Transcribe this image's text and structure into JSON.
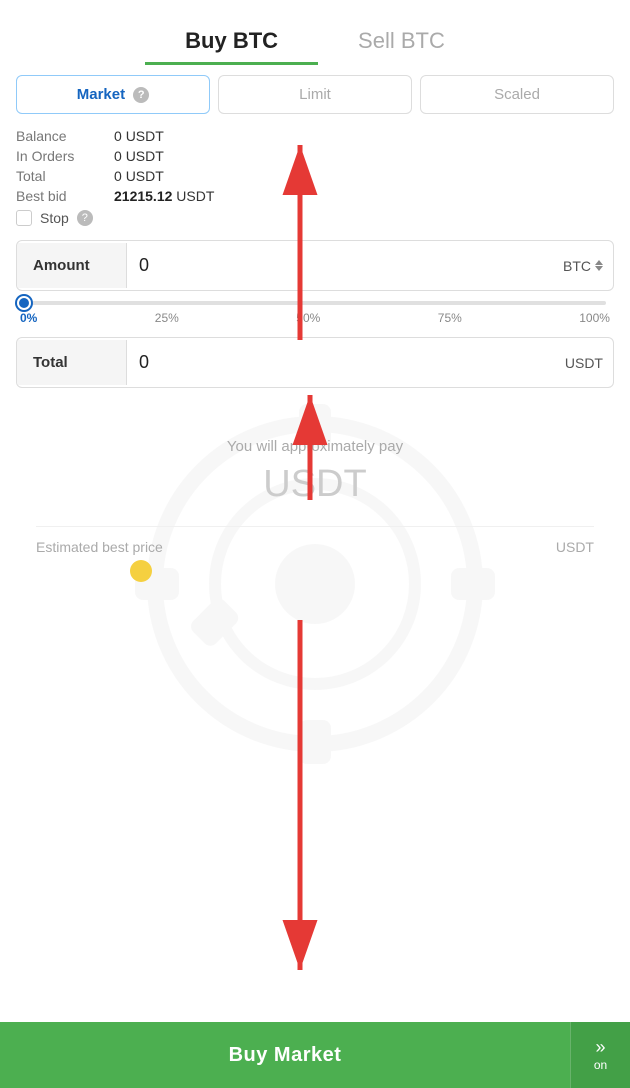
{
  "header": {
    "buy_tab": "Buy BTC",
    "sell_tab": "Sell BTC"
  },
  "order_types": [
    {
      "id": "market",
      "label": "Market",
      "active": true,
      "has_help": true
    },
    {
      "id": "limit",
      "label": "Limit",
      "active": false,
      "has_help": false
    },
    {
      "id": "scaled",
      "label": "Scaled",
      "active": false,
      "has_help": false
    }
  ],
  "balance_info": {
    "balance_label": "Balance",
    "balance_value": "0",
    "balance_currency": "USDT",
    "in_orders_label": "In Orders",
    "in_orders_value": "0",
    "in_orders_currency": "USDT",
    "total_label": "Total",
    "total_value": "0",
    "total_currency": "USDT",
    "best_bid_label": "Best bid",
    "best_bid_value": "21215.12",
    "best_bid_currency": "USDT",
    "stop_label": "Stop",
    "help_icon": "?"
  },
  "amount_field": {
    "label": "Amount",
    "value": "0",
    "currency": "BTC"
  },
  "slider": {
    "percentage": 0,
    "labels": [
      "0%",
      "25%",
      "50%",
      "75%",
      "100%"
    ]
  },
  "total_field": {
    "label": "Total",
    "value": "0",
    "currency": "USDT"
  },
  "approx": {
    "label": "You will approximately pay",
    "amount": "USDT",
    "estimated_label": "Estimated best price",
    "estimated_currency": "USDT"
  },
  "buy_button": {
    "label": "Buy Market",
    "on_label": "on",
    "chevrons": "»"
  }
}
